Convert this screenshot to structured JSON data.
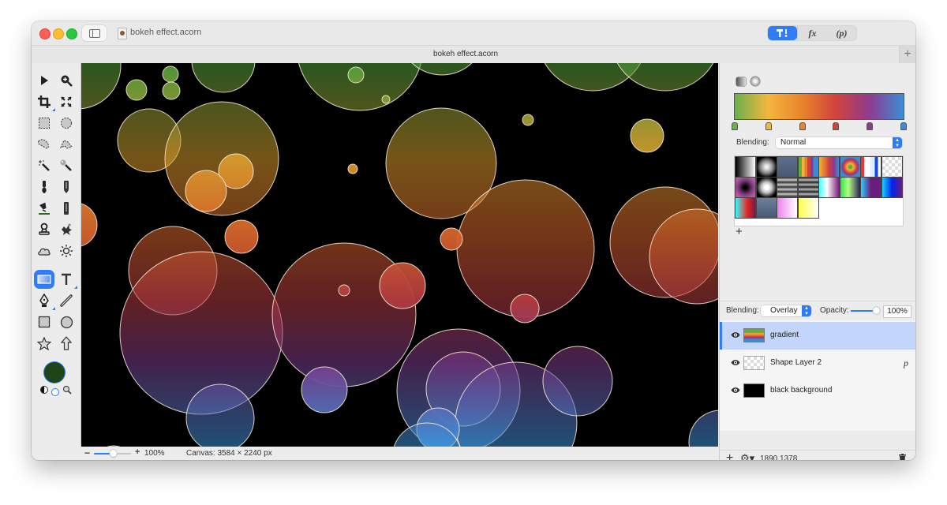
{
  "window": {
    "title": "bokeh effect.acorn",
    "tab_title": "bokeh effect.acorn",
    "toolbar_segments": [
      {
        "name": "tools",
        "label": "T!",
        "active": true
      },
      {
        "name": "filters",
        "label": "fx",
        "active": false
      },
      {
        "name": "plugins",
        "label": "(p)",
        "active": false
      }
    ],
    "add_tab_label": "+"
  },
  "toolbox": {
    "tools": [
      "move-tool",
      "zoom-tool",
      "crop-tool",
      "transform-tool",
      "rect-select-tool",
      "ellipse-select-tool",
      "lasso-tool",
      "polygon-lasso-tool",
      "magic-wand-tool",
      "magic-select-tool",
      "brush-tool",
      "pencil-tool",
      "paint-bucket-tool",
      "eraser-tool",
      "clone-tool",
      "smudge-tool",
      "cloud-tool",
      "sun-tool",
      "gradient-tool",
      "text-tool",
      "pen-tool",
      "line-tool",
      "rectangle-shape-tool",
      "oval-shape-tool",
      "star-tool",
      "arrow-tool"
    ],
    "active_tool": "gradient-tool",
    "foreground_color": "#1f4417"
  },
  "status": {
    "zoom_minus": "−",
    "zoom_plus": "+",
    "zoom_level": "100%",
    "zoom_fraction": 0.5,
    "canvas_size": "Canvas: 3584 × 2240 px"
  },
  "gradient_panel": {
    "gradient_stops": [
      "#6ab04c",
      "#f4b63f",
      "#e9832b",
      "#d0433c",
      "#8e3b8f",
      "#3b8ed6"
    ],
    "blending_label": "Blending:",
    "blending_value": "Normal",
    "add_preset_label": "+"
  },
  "layer_panel": {
    "blending_label": "Blending:",
    "blending_value": "Overlay",
    "opacity_label": "Opacity:",
    "opacity_value": "100%",
    "opacity_fraction": 1.0,
    "layers": [
      {
        "name": "gradient",
        "selected": true,
        "visible": true,
        "badge": ""
      },
      {
        "name": "Shape Layer 2",
        "selected": false,
        "visible": true,
        "badge": "p"
      },
      {
        "name": "black background",
        "selected": false,
        "visible": true,
        "badge": ""
      }
    ],
    "footer": {
      "add_label": "+",
      "gear_label": "⚙▾",
      "coordinates": "1890,1378"
    }
  }
}
